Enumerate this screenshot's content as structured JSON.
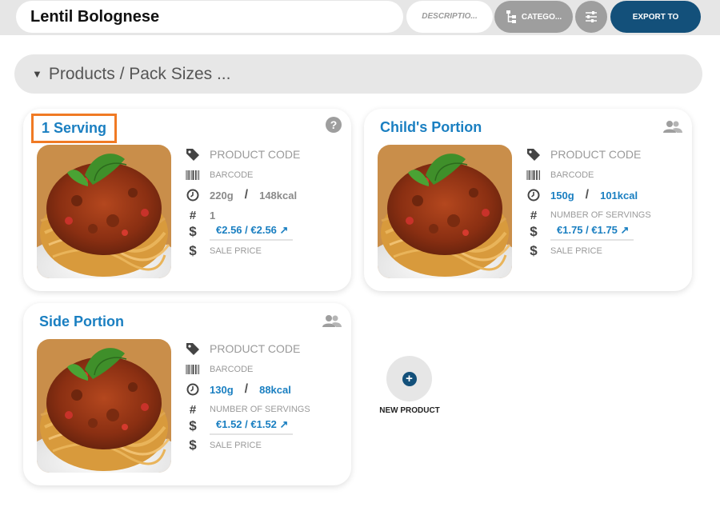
{
  "header": {
    "recipe_name": "Lentil Bolognese",
    "description_placeholder": "DESCRIPTIO...",
    "category_label": "CATEGO...",
    "export_label": "EXPORT TO"
  },
  "section": {
    "title": "Products / Pack Sizes ..."
  },
  "products": [
    {
      "title": "1 Serving",
      "product_code": "PRODUCT CODE",
      "barcode": "BARCODE",
      "weight": "220g",
      "energy": "148kcal",
      "servings": "1",
      "price": "€2.56  / €2.56 ↗",
      "sale_price": "SALE PRICE"
    },
    {
      "title": "Child's Portion",
      "product_code": "PRODUCT CODE",
      "barcode": "BARCODE",
      "weight": "150g",
      "energy": "101kcal",
      "servings": "NUMBER OF SERVINGS",
      "price": "€1.75  / €1.75 ↗",
      "sale_price": "SALE PRICE"
    },
    {
      "title": "Side Portion",
      "product_code": "PRODUCT CODE",
      "barcode": "BARCODE",
      "weight": "130g",
      "energy": "88kcal",
      "servings": "NUMBER OF SERVINGS",
      "price": "€1.52  / €1.52 ↗",
      "sale_price": "SALE PRICE"
    }
  ],
  "new_product": {
    "label": "NEW PRODUCT"
  },
  "icons": {
    "tag": "tag-icon",
    "barcode": "barcode-icon",
    "clock": "clock-icon",
    "hash": "hash-icon",
    "dollar": "dollar-icon",
    "help": "help-icon",
    "users": "users-icon",
    "category": "category-tree-icon",
    "filter": "sliders-icon",
    "plus": "plus-icon"
  },
  "colors": {
    "accent_blue": "#1a7fc1",
    "export_button": "#13507a",
    "highlight_border": "#f07a24"
  }
}
